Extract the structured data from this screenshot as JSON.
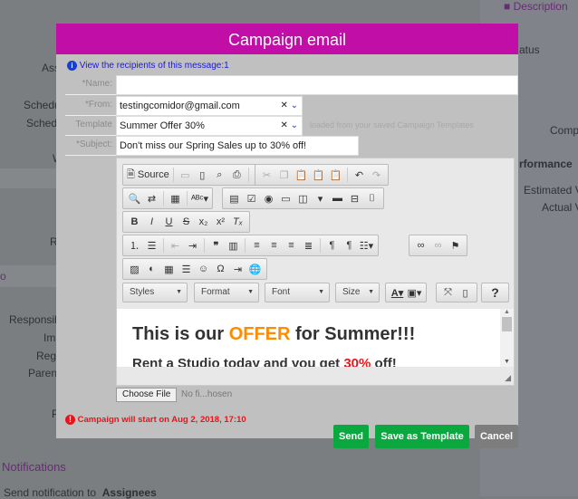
{
  "background": {
    "right_panel": [
      "Description",
      "atus",
      "Comp",
      "rformance",
      "Estimated V",
      "Actual V"
    ],
    "left_labels": [
      "Ass",
      "Schedu",
      "Sched",
      "W",
      "R",
      "o",
      "Responsib",
      "Im",
      "Reg",
      "Paren",
      "P"
    ],
    "notifications_heading": "Notifications",
    "send_notification_label": "Send notification to",
    "send_notification_value": "Assignees"
  },
  "modal": {
    "title": "Campaign email",
    "recipients_link": "View the recipients of this message:1",
    "name_label": "*Name:",
    "name_value": "",
    "from_label": "*From:",
    "from_value": "testingcomidor@gmail.com",
    "template_label": "Template",
    "template_value": "Summer Offer 30%",
    "template_hint": "loaded from your saved Campaign Templates",
    "subject_label": "*Subject:",
    "subject_value": "Don't miss our Spring Sales up to 30% off!",
    "toolbar": {
      "source": "Source",
      "styles": "Styles",
      "format": "Format",
      "font": "Font",
      "size": "Size",
      "help": "?"
    },
    "content": {
      "h_pre": "This is our ",
      "h_offer": "OFFER",
      "h_post": " for Summer!!!",
      "p_pre": "Rent a Studio today and you get ",
      "p_pct": "30%",
      "p_post": " off!"
    },
    "choose_file": "Choose File",
    "no_file": "No fi...hosen",
    "warning": "Campaign will start on Aug 2, 2018, 17:10",
    "send": "Send",
    "save_template": "Save as Template",
    "cancel": "Cancel"
  },
  "colors": {
    "header": "#c00ea6",
    "send": "#0aa83f",
    "cancel": "#7d7d7d",
    "warning": "#e8141a",
    "offer": "#ff8c00",
    "pct": "#e8141a"
  }
}
